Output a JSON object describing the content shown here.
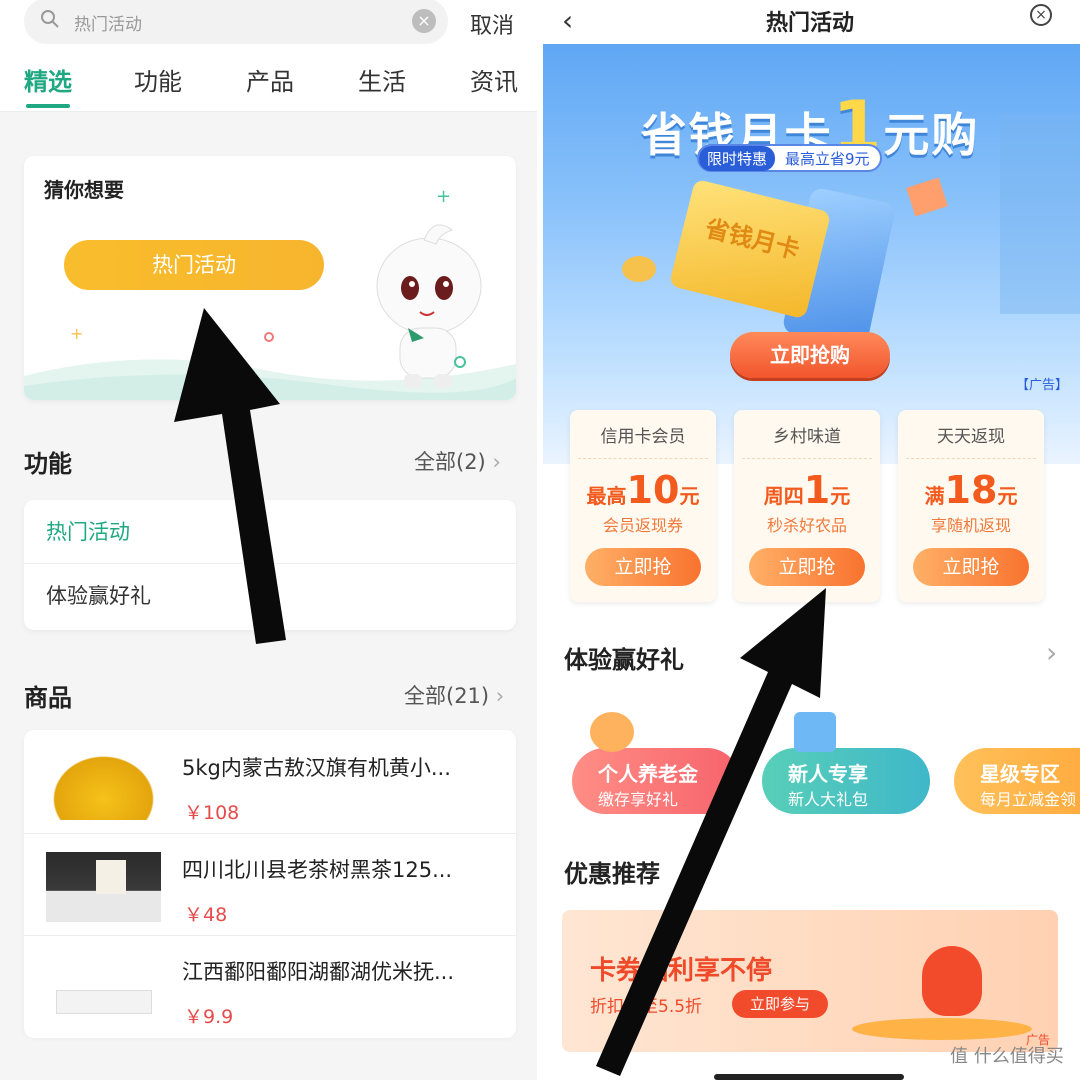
{
  "left": {
    "search": {
      "placeholder": "热门活动",
      "cancel": "取消"
    },
    "tabs": [
      "精选",
      "功能",
      "产品",
      "生活",
      "资讯"
    ],
    "guess": {
      "title": "猜你想要",
      "button": "热门活动"
    },
    "functions": {
      "title": "功能",
      "more": "全部(2)",
      "items": [
        "热门活动",
        "体验赢好礼"
      ]
    },
    "goods": {
      "title": "商品",
      "more": "全部(21)",
      "items": [
        {
          "name": "5kg内蒙古敖汉旗有机黄小...",
          "price": "￥108"
        },
        {
          "name": "四川北川县老茶树黑茶125...",
          "price": "￥48"
        },
        {
          "name": "江西鄱阳鄱阳湖鄱湖优米抚...",
          "price": "￥9.9"
        }
      ]
    }
  },
  "right": {
    "title": "热门活动",
    "banner": {
      "title_pre": "省钱月卡",
      "title_num": "1",
      "title_post": "元购",
      "tag_a": "限时特惠",
      "tag_b": "最高立省9元",
      "card_text": "省钱月卡",
      "button": "立即抢购",
      "ad": "【广告】"
    },
    "coupons": [
      {
        "name": "信用卡会员",
        "pre": "最高",
        "num": "10",
        "unit": "元",
        "sub": "会员返现券",
        "btn": "立即抢"
      },
      {
        "name": "乡村味道",
        "pre": "周四",
        "num": "1",
        "unit": "元",
        "sub": "秒杀好农品",
        "btn": "立即抢"
      },
      {
        "name": "天天返现",
        "pre": "满",
        "num": "18",
        "unit": "元",
        "sub": "享随机返现",
        "btn": "立即抢"
      }
    ],
    "experience": {
      "title": "体验赢好礼",
      "cards": [
        {
          "t": "个人养老金",
          "s": "缴存享好礼"
        },
        {
          "t": "新人专享",
          "s": "新人大礼包"
        },
        {
          "t": "星级专区",
          "s": "每月立减金领"
        }
      ]
    },
    "promo": {
      "title": "优惠推荐",
      "main": "卡券福利享不停",
      "sub": "折扣低至5.5折",
      "button": "立即参与",
      "ad": "广告"
    }
  },
  "watermark": "值 什么值得买",
  "colors": {
    "green": "#20a882",
    "orange": "#f8bd2c",
    "red": "#e64b4b",
    "blue": "#2a5ed8"
  }
}
